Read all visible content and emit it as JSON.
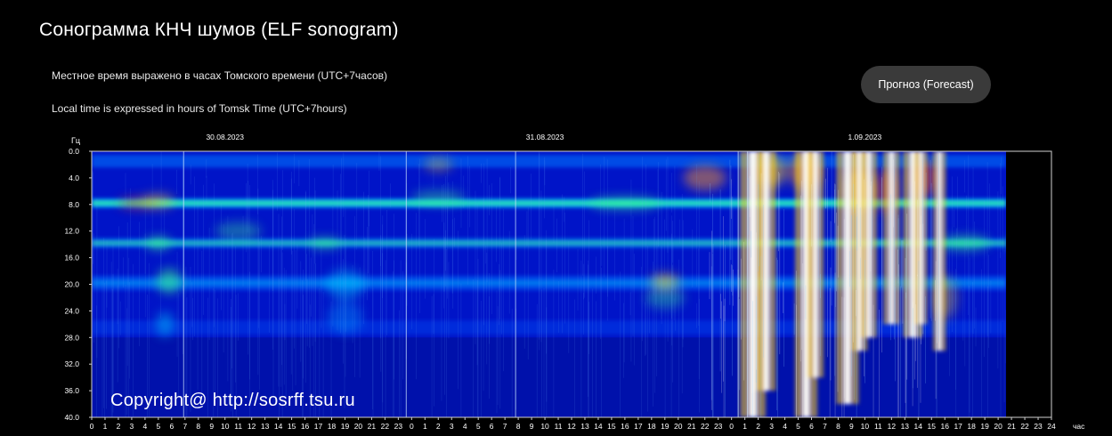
{
  "page": {
    "title": "Сонограмма КНЧ шумов (ELF sonogram)",
    "note_ru": "Местное время выражено в часах Томского времени (UTC+7часов)",
    "note_en": "Local time is expressed in hours of Tomsk Time (UTC+7hours)",
    "forecast_button": "Прогноз (Forecast)"
  },
  "sonogram": {
    "y_unit": "Гц",
    "x_unit": "час",
    "y_ticks": [
      "0.0",
      "4.0",
      "8.0",
      "12.0",
      "16.0",
      "20.0",
      "24.0",
      "28.0",
      "32.0",
      "36.0",
      "40.0"
    ],
    "date_labels": [
      "30.08.2023",
      "31.08.2023",
      "1.09.2023"
    ],
    "hour_ticks": [
      "0",
      "1",
      "2",
      "3",
      "4",
      "5",
      "6",
      "7",
      "8",
      "9",
      "10",
      "11",
      "12",
      "13",
      "14",
      "15",
      "16",
      "17",
      "18",
      "19",
      "20",
      "21",
      "22",
      "23",
      "0",
      "1",
      "2",
      "3",
      "4",
      "5",
      "6",
      "7",
      "8",
      "9",
      "10",
      "11",
      "12",
      "13",
      "14",
      "15",
      "16",
      "17",
      "18",
      "19",
      "20",
      "21",
      "22",
      "23",
      "0",
      "1",
      "2",
      "3",
      "4",
      "5",
      "6",
      "7",
      "8",
      "9",
      "10",
      "11",
      "12",
      "13",
      "14",
      "15",
      "16",
      "17",
      "18",
      "19",
      "20",
      "21",
      "22",
      "23",
      "24"
    ],
    "copyright": "Copyright@ http://sosrff.tsu.ru",
    "colors": {
      "background": "#0014c8",
      "band": "#00d2ff",
      "resonance": "#3cff8c",
      "burst": "#ffffff",
      "hot": "#e03c1e"
    }
  }
}
